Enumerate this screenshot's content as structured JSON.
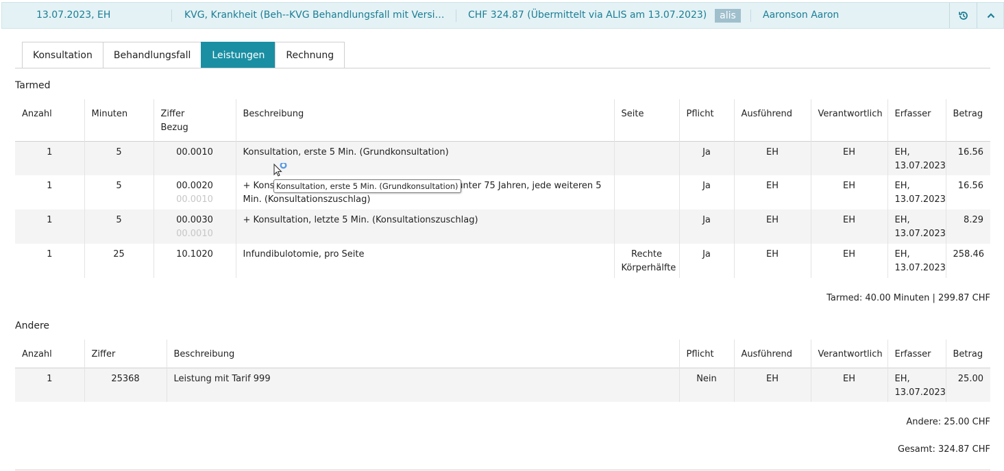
{
  "header": {
    "date_user": "13.07.2023, EH",
    "case": "KVG, Krankheit (Beh--KVG Behandlungsfall mit Versicherung)",
    "amount": "CHF 324.87 (Übermittelt via ALIS am 13.07.2023)",
    "badge": "alis",
    "patient": "Aaronson Aaron",
    "history_icon": "history-icon",
    "collapse_icon": "chevron-up-icon"
  },
  "tabs": [
    {
      "label": "Konsultation"
    },
    {
      "label": "Behandlungsfall"
    },
    {
      "label": "Leistungen",
      "active": true
    },
    {
      "label": "Rechnung"
    }
  ],
  "tarmed": {
    "title": "Tarmed",
    "headers": {
      "anzahl": "Anzahl",
      "minuten": "Minuten",
      "ziffer": "Ziffer",
      "bezug": "Bezug",
      "beschreibung": "Beschreibung",
      "seite": "Seite",
      "pflicht": "Pflicht",
      "ausfuehrend": "Ausführend",
      "verantwortlich": "Verantwortlich",
      "erfasser": "Erfasser",
      "betrag": "Betrag"
    },
    "rows": [
      {
        "anzahl": "1",
        "minuten": "5",
        "ziffer": "00.0010",
        "bezug": "",
        "beschreibung": "Konsultation, erste 5 Min. (Grundkonsultation)",
        "seite": "",
        "pflicht": "Ja",
        "ausfuehrend": "EH",
        "verantwortlich": "EH",
        "erfasser": "EH,",
        "erfasser_date": "13.07.2023",
        "betrag": "16.56"
      },
      {
        "anzahl": "1",
        "minuten": "5",
        "ziffer": "00.0020",
        "bezug": "00.0010",
        "beschreibung": "+ Konsultation, bei Personen über 6 Jahren und unter 75 Jahren, jede weiteren 5 Min. (Konsultationszuschlag)",
        "seite": "",
        "pflicht": "Ja",
        "ausfuehrend": "EH",
        "verantwortlich": "EH",
        "erfasser": "EH,",
        "erfasser_date": "13.07.2023",
        "betrag": "16.56"
      },
      {
        "anzahl": "1",
        "minuten": "5",
        "ziffer": "00.0030",
        "bezug": "00.0010",
        "beschreibung": "+ Konsultation, letzte 5 Min. (Konsultationszuschlag)",
        "seite": "",
        "pflicht": "Ja",
        "ausfuehrend": "EH",
        "verantwortlich": "EH",
        "erfasser": "EH,",
        "erfasser_date": "13.07.2023",
        "betrag": "8.29"
      },
      {
        "anzahl": "1",
        "minuten": "25",
        "ziffer": "10.1020",
        "bezug": "",
        "beschreibung": "Infundibulotomie, pro Seite",
        "seite": "Rechte Körperhälfte",
        "pflicht": "Ja",
        "ausfuehrend": "EH",
        "verantwortlich": "EH",
        "erfasser": "EH,",
        "erfasser_date": "13.07.2023",
        "betrag": "258.46"
      }
    ],
    "summary": "Tarmed: 40.00 Minuten | 299.87 CHF"
  },
  "andere": {
    "title": "Andere",
    "headers": {
      "anzahl": "Anzahl",
      "ziffer": "Ziffer",
      "beschreibung": "Beschreibung",
      "pflicht": "Pflicht",
      "ausfuehrend": "Ausführend",
      "verantwortlich": "Verantwortlich",
      "erfasser": "Erfasser",
      "betrag": "Betrag"
    },
    "rows": [
      {
        "anzahl": "1",
        "ziffer": "25368",
        "beschreibung": "Leistung mit Tarif 999",
        "pflicht": "Nein",
        "ausfuehrend": "EH",
        "verantwortlich": "EH",
        "erfasser": "EH,",
        "erfasser_date": "13.07.2023",
        "betrag": "25.00"
      }
    ],
    "summary": "Andere: 25.00 CHF"
  },
  "total": "Gesamt: 324.87 CHF",
  "tooltip": "Konsultation, erste 5 Min. (Grundkonsultation)"
}
